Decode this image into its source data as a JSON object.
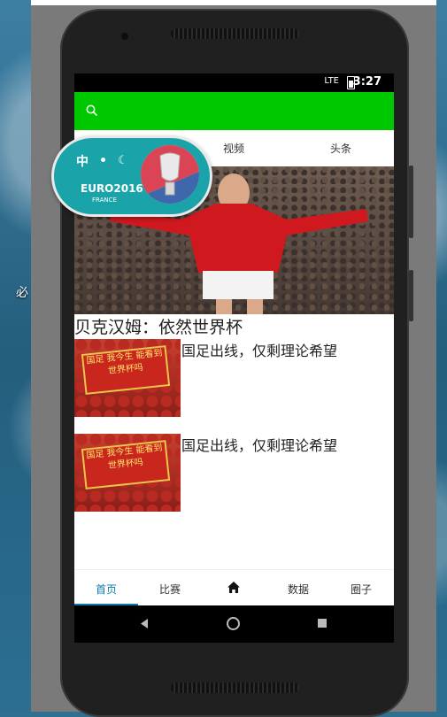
{
  "desktop": {
    "label": "必"
  },
  "status_bar": {
    "network": "LTE",
    "time": "3:27"
  },
  "search": {
    "placeholder": ""
  },
  "tabs": [
    {
      "label": "视频"
    },
    {
      "label": "头条"
    }
  ],
  "euro_badge": {
    "lang_label": "中",
    "logo_text": "EURO2016",
    "logo_sub": "FRANCE"
  },
  "hero": {
    "title": "贝克汉姆：依然世界杯"
  },
  "news": [
    {
      "title": "国足出线，仅剩理论希望",
      "banner": "国足 我今生\n能看到世界杯吗"
    },
    {
      "title": "国足出线，仅剩理论希望",
      "banner": "国足 我今生\n能看到世界杯吗"
    }
  ],
  "bottom_nav": [
    {
      "label": "首页"
    },
    {
      "label": "比赛"
    },
    {
      "label": "数据"
    },
    {
      "label": "圈子"
    }
  ],
  "colors": {
    "search_bar": "#00c800",
    "active_nav": "#0a7aa8",
    "badge": "#1aa3a8"
  }
}
